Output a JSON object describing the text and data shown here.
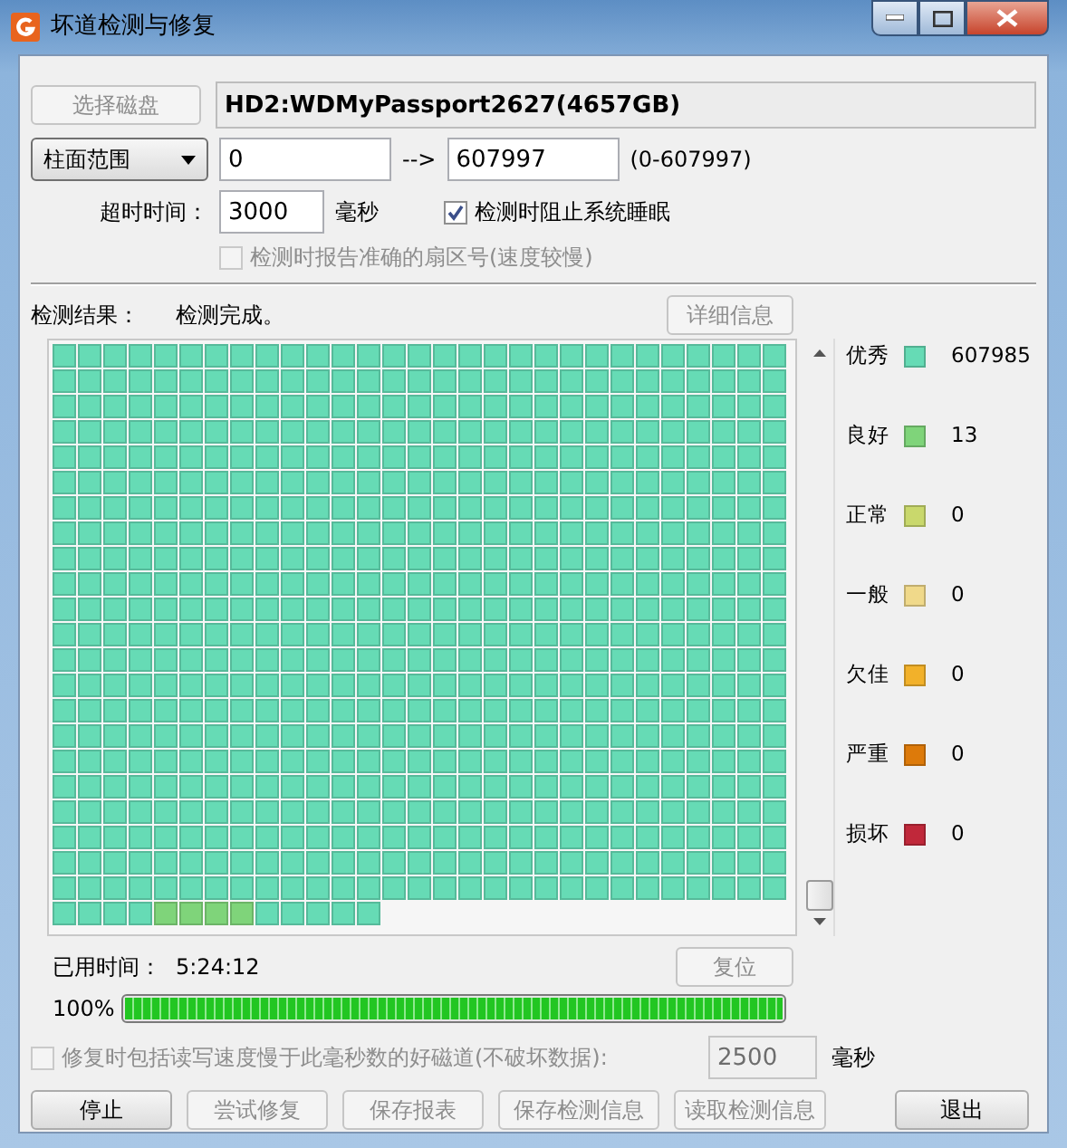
{
  "window": {
    "title": "坏道检测与修复"
  },
  "disk": {
    "select_button": {
      "label": "选择磁盘",
      "disabled": true
    },
    "name": "HD2:WDMyPassport2627(4657GB)"
  },
  "range": {
    "mode": "柱面范围",
    "from": "0",
    "arrow": "-->",
    "to": "607997",
    "hint": "(0-607997)"
  },
  "timeout": {
    "label": "超时时间：",
    "value": "3000",
    "unit": "毫秒"
  },
  "options": [
    {
      "label": "检测时阻止系统睡眠",
      "checked": true,
      "disabled": false
    },
    {
      "label": "检测时报告准确的扇区号(速度较慢)",
      "checked": false,
      "disabled": true
    }
  ],
  "result": {
    "label": "检测结果：",
    "status": "检测完成。",
    "details_button": {
      "label": "详细信息",
      "disabled": true
    }
  },
  "block_map": {
    "rows": [
      [
        {
          "kind": "excellent"
        },
        {
          "kind": "excellent"
        },
        {
          "kind": "excellent"
        },
        {
          "kind": "excellent"
        },
        {
          "kind": "excellent"
        },
        {
          "kind": "excellent"
        },
        {
          "kind": "excellent"
        },
        {
          "kind": "excellent"
        },
        {
          "kind": "excellent"
        },
        {
          "kind": "excellent"
        },
        {
          "kind": "excellent"
        },
        {
          "kind": "excellent"
        },
        {
          "kind": "excellent"
        },
        {
          "kind": "excellent"
        },
        {
          "kind": "excellent"
        },
        {
          "kind": "excellent"
        },
        {
          "kind": "excellent"
        },
        {
          "kind": "excellent"
        },
        {
          "kind": "excellent"
        },
        {
          "kind": "excellent"
        },
        {
          "kind": "excellent"
        },
        {
          "kind": "excellent"
        },
        {
          "kind": "excellent"
        },
        {
          "kind": "excellent"
        },
        {
          "kind": "excellent"
        },
        {
          "kind": "excellent"
        },
        {
          "kind": "excellent"
        },
        {
          "kind": "excellent"
        },
        {
          "kind": "excellent"
        }
      ],
      [
        {
          "kind": "excellent"
        },
        {
          "kind": "excellent"
        },
        {
          "kind": "excellent"
        },
        {
          "kind": "excellent"
        },
        {
          "kind": "excellent"
        },
        {
          "kind": "excellent"
        },
        {
          "kind": "excellent"
        },
        {
          "kind": "excellent"
        },
        {
          "kind": "excellent"
        },
        {
          "kind": "excellent"
        },
        {
          "kind": "excellent"
        },
        {
          "kind": "excellent"
        },
        {
          "kind": "excellent"
        },
        {
          "kind": "excellent"
        },
        {
          "kind": "excellent"
        },
        {
          "kind": "excellent"
        },
        {
          "kind": "excellent"
        },
        {
          "kind": "excellent"
        },
        {
          "kind": "excellent"
        },
        {
          "kind": "excellent"
        },
        {
          "kind": "excellent"
        },
        {
          "kind": "excellent"
        },
        {
          "kind": "excellent"
        },
        {
          "kind": "excellent"
        },
        {
          "kind": "excellent"
        },
        {
          "kind": "excellent"
        },
        {
          "kind": "excellent"
        },
        {
          "kind": "excellent"
        },
        {
          "kind": "excellent"
        }
      ],
      [
        {
          "kind": "excellent"
        },
        {
          "kind": "excellent"
        },
        {
          "kind": "excellent"
        },
        {
          "kind": "excellent"
        },
        {
          "kind": "excellent"
        },
        {
          "kind": "excellent"
        },
        {
          "kind": "excellent"
        },
        {
          "kind": "excellent"
        },
        {
          "kind": "excellent"
        },
        {
          "kind": "excellent"
        },
        {
          "kind": "excellent"
        },
        {
          "kind": "excellent"
        },
        {
          "kind": "excellent"
        },
        {
          "kind": "excellent"
        },
        {
          "kind": "excellent"
        },
        {
          "kind": "excellent"
        },
        {
          "kind": "excellent"
        },
        {
          "kind": "excellent"
        },
        {
          "kind": "excellent"
        },
        {
          "kind": "excellent"
        },
        {
          "kind": "excellent"
        },
        {
          "kind": "excellent"
        },
        {
          "kind": "excellent"
        },
        {
          "kind": "excellent"
        },
        {
          "kind": "excellent"
        },
        {
          "kind": "excellent"
        },
        {
          "kind": "excellent"
        },
        {
          "kind": "excellent"
        },
        {
          "kind": "excellent"
        }
      ],
      [
        {
          "kind": "excellent"
        },
        {
          "kind": "excellent"
        },
        {
          "kind": "excellent"
        },
        {
          "kind": "excellent"
        },
        {
          "kind": "excellent"
        },
        {
          "kind": "excellent"
        },
        {
          "kind": "excellent"
        },
        {
          "kind": "excellent"
        },
        {
          "kind": "excellent"
        },
        {
          "kind": "excellent"
        },
        {
          "kind": "excellent"
        },
        {
          "kind": "excellent"
        },
        {
          "kind": "excellent"
        },
        {
          "kind": "excellent"
        },
        {
          "kind": "excellent"
        },
        {
          "kind": "excellent"
        },
        {
          "kind": "excellent"
        },
        {
          "kind": "excellent"
        },
        {
          "kind": "excellent"
        },
        {
          "kind": "excellent"
        },
        {
          "kind": "excellent"
        },
        {
          "kind": "excellent"
        },
        {
          "kind": "excellent"
        },
        {
          "kind": "excellent"
        },
        {
          "kind": "excellent"
        },
        {
          "kind": "excellent"
        },
        {
          "kind": "excellent"
        },
        {
          "kind": "excellent"
        },
        {
          "kind": "excellent"
        }
      ],
      [
        {
          "kind": "excellent"
        },
        {
          "kind": "excellent"
        },
        {
          "kind": "excellent"
        },
        {
          "kind": "excellent"
        },
        {
          "kind": "excellent"
        },
        {
          "kind": "excellent"
        },
        {
          "kind": "excellent"
        },
        {
          "kind": "excellent"
        },
        {
          "kind": "excellent"
        },
        {
          "kind": "excellent"
        },
        {
          "kind": "excellent"
        },
        {
          "kind": "excellent"
        },
        {
          "kind": "excellent"
        },
        {
          "kind": "excellent"
        },
        {
          "kind": "excellent"
        },
        {
          "kind": "excellent"
        },
        {
          "kind": "excellent"
        },
        {
          "kind": "excellent"
        },
        {
          "kind": "excellent"
        },
        {
          "kind": "excellent"
        },
        {
          "kind": "excellent"
        },
        {
          "kind": "excellent"
        },
        {
          "kind": "excellent"
        },
        {
          "kind": "excellent"
        },
        {
          "kind": "excellent"
        },
        {
          "kind": "excellent"
        },
        {
          "kind": "excellent"
        },
        {
          "kind": "excellent"
        },
        {
          "kind": "excellent"
        }
      ],
      [
        {
          "kind": "excellent"
        },
        {
          "kind": "excellent"
        },
        {
          "kind": "excellent"
        },
        {
          "kind": "excellent"
        },
        {
          "kind": "excellent"
        },
        {
          "kind": "excellent"
        },
        {
          "kind": "excellent"
        },
        {
          "kind": "excellent"
        },
        {
          "kind": "excellent"
        },
        {
          "kind": "excellent"
        },
        {
          "kind": "excellent"
        },
        {
          "kind": "excellent"
        },
        {
          "kind": "excellent"
        },
        {
          "kind": "excellent"
        },
        {
          "kind": "excellent"
        },
        {
          "kind": "excellent"
        },
        {
          "kind": "excellent"
        },
        {
          "kind": "excellent"
        },
        {
          "kind": "excellent"
        },
        {
          "kind": "excellent"
        },
        {
          "kind": "excellent"
        },
        {
          "kind": "excellent"
        },
        {
          "kind": "excellent"
        },
        {
          "kind": "excellent"
        },
        {
          "kind": "excellent"
        },
        {
          "kind": "excellent"
        },
        {
          "kind": "excellent"
        },
        {
          "kind": "excellent"
        },
        {
          "kind": "excellent"
        }
      ],
      [
        {
          "kind": "excellent"
        },
        {
          "kind": "excellent"
        },
        {
          "kind": "excellent"
        },
        {
          "kind": "excellent"
        },
        {
          "kind": "excellent"
        },
        {
          "kind": "excellent"
        },
        {
          "kind": "excellent"
        },
        {
          "kind": "excellent"
        },
        {
          "kind": "excellent"
        },
        {
          "kind": "excellent"
        },
        {
          "kind": "excellent"
        },
        {
          "kind": "excellent"
        },
        {
          "kind": "excellent"
        },
        {
          "kind": "excellent"
        },
        {
          "kind": "excellent"
        },
        {
          "kind": "excellent"
        },
        {
          "kind": "excellent"
        },
        {
          "kind": "excellent"
        },
        {
          "kind": "excellent"
        },
        {
          "kind": "excellent"
        },
        {
          "kind": "excellent"
        },
        {
          "kind": "excellent"
        },
        {
          "kind": "excellent"
        },
        {
          "kind": "excellent"
        },
        {
          "kind": "excellent"
        },
        {
          "kind": "excellent"
        },
        {
          "kind": "excellent"
        },
        {
          "kind": "excellent"
        },
        {
          "kind": "excellent"
        }
      ],
      [
        {
          "kind": "excellent"
        },
        {
          "kind": "excellent"
        },
        {
          "kind": "excellent"
        },
        {
          "kind": "excellent"
        },
        {
          "kind": "excellent"
        },
        {
          "kind": "excellent"
        },
        {
          "kind": "excellent"
        },
        {
          "kind": "excellent"
        },
        {
          "kind": "excellent"
        },
        {
          "kind": "excellent"
        },
        {
          "kind": "excellent"
        },
        {
          "kind": "excellent"
        },
        {
          "kind": "excellent"
        },
        {
          "kind": "excellent"
        },
        {
          "kind": "excellent"
        },
        {
          "kind": "excellent"
        },
        {
          "kind": "excellent"
        },
        {
          "kind": "excellent"
        },
        {
          "kind": "excellent"
        },
        {
          "kind": "excellent"
        },
        {
          "kind": "excellent"
        },
        {
          "kind": "excellent"
        },
        {
          "kind": "excellent"
        },
        {
          "kind": "excellent"
        },
        {
          "kind": "excellent"
        },
        {
          "kind": "excellent"
        },
        {
          "kind": "excellent"
        },
        {
          "kind": "excellent"
        },
        {
          "kind": "excellent"
        }
      ],
      [
        {
          "kind": "excellent"
        },
        {
          "kind": "excellent"
        },
        {
          "kind": "excellent"
        },
        {
          "kind": "excellent"
        },
        {
          "kind": "excellent"
        },
        {
          "kind": "excellent"
        },
        {
          "kind": "excellent"
        },
        {
          "kind": "excellent"
        },
        {
          "kind": "excellent"
        },
        {
          "kind": "excellent"
        },
        {
          "kind": "excellent"
        },
        {
          "kind": "excellent"
        },
        {
          "kind": "excellent"
        },
        {
          "kind": "excellent"
        },
        {
          "kind": "excellent"
        },
        {
          "kind": "excellent"
        },
        {
          "kind": "excellent"
        },
        {
          "kind": "excellent"
        },
        {
          "kind": "excellent"
        },
        {
          "kind": "excellent"
        },
        {
          "kind": "excellent"
        },
        {
          "kind": "excellent"
        },
        {
          "kind": "excellent"
        },
        {
          "kind": "excellent"
        },
        {
          "kind": "excellent"
        },
        {
          "kind": "excellent"
        },
        {
          "kind": "excellent"
        },
        {
          "kind": "excellent"
        },
        {
          "kind": "excellent"
        }
      ],
      [
        {
          "kind": "excellent"
        },
        {
          "kind": "excellent"
        },
        {
          "kind": "excellent"
        },
        {
          "kind": "excellent"
        },
        {
          "kind": "excellent"
        },
        {
          "kind": "excellent"
        },
        {
          "kind": "excellent"
        },
        {
          "kind": "excellent"
        },
        {
          "kind": "excellent"
        },
        {
          "kind": "excellent"
        },
        {
          "kind": "excellent"
        },
        {
          "kind": "excellent"
        },
        {
          "kind": "excellent"
        },
        {
          "kind": "excellent"
        },
        {
          "kind": "excellent"
        },
        {
          "kind": "excellent"
        },
        {
          "kind": "excellent"
        },
        {
          "kind": "excellent"
        },
        {
          "kind": "excellent"
        },
        {
          "kind": "excellent"
        },
        {
          "kind": "excellent"
        },
        {
          "kind": "excellent"
        },
        {
          "kind": "excellent"
        },
        {
          "kind": "excellent"
        },
        {
          "kind": "excellent"
        },
        {
          "kind": "excellent"
        },
        {
          "kind": "excellent"
        },
        {
          "kind": "excellent"
        },
        {
          "kind": "excellent"
        }
      ],
      [
        {
          "kind": "excellent"
        },
        {
          "kind": "excellent"
        },
        {
          "kind": "excellent"
        },
        {
          "kind": "excellent"
        },
        {
          "kind": "excellent"
        },
        {
          "kind": "excellent"
        },
        {
          "kind": "excellent"
        },
        {
          "kind": "excellent"
        },
        {
          "kind": "excellent"
        },
        {
          "kind": "excellent"
        },
        {
          "kind": "excellent"
        },
        {
          "kind": "excellent"
        },
        {
          "kind": "excellent"
        },
        {
          "kind": "excellent"
        },
        {
          "kind": "excellent"
        },
        {
          "kind": "excellent"
        },
        {
          "kind": "excellent"
        },
        {
          "kind": "excellent"
        },
        {
          "kind": "excellent"
        },
        {
          "kind": "excellent"
        },
        {
          "kind": "excellent"
        },
        {
          "kind": "excellent"
        },
        {
          "kind": "excellent"
        },
        {
          "kind": "excellent"
        },
        {
          "kind": "excellent"
        },
        {
          "kind": "excellent"
        },
        {
          "kind": "excellent"
        },
        {
          "kind": "excellent"
        },
        {
          "kind": "excellent"
        }
      ],
      [
        {
          "kind": "excellent"
        },
        {
          "kind": "excellent"
        },
        {
          "kind": "excellent"
        },
        {
          "kind": "excellent"
        },
        {
          "kind": "excellent"
        },
        {
          "kind": "excellent"
        },
        {
          "kind": "excellent"
        },
        {
          "kind": "excellent"
        },
        {
          "kind": "excellent"
        },
        {
          "kind": "excellent"
        },
        {
          "kind": "excellent"
        },
        {
          "kind": "excellent"
        },
        {
          "kind": "excellent"
        },
        {
          "kind": "excellent"
        },
        {
          "kind": "excellent"
        },
        {
          "kind": "excellent"
        },
        {
          "kind": "excellent"
        },
        {
          "kind": "excellent"
        },
        {
          "kind": "excellent"
        },
        {
          "kind": "excellent"
        },
        {
          "kind": "excellent"
        },
        {
          "kind": "excellent"
        },
        {
          "kind": "excellent"
        },
        {
          "kind": "excellent"
        },
        {
          "kind": "excellent"
        },
        {
          "kind": "excellent"
        },
        {
          "kind": "excellent"
        },
        {
          "kind": "excellent"
        },
        {
          "kind": "excellent"
        }
      ],
      [
        {
          "kind": "excellent"
        },
        {
          "kind": "excellent"
        },
        {
          "kind": "excellent"
        },
        {
          "kind": "excellent"
        },
        {
          "kind": "excellent"
        },
        {
          "kind": "excellent"
        },
        {
          "kind": "excellent"
        },
        {
          "kind": "excellent"
        },
        {
          "kind": "excellent"
        },
        {
          "kind": "excellent"
        },
        {
          "kind": "excellent"
        },
        {
          "kind": "excellent"
        },
        {
          "kind": "excellent"
        },
        {
          "kind": "excellent"
        },
        {
          "kind": "excellent"
        },
        {
          "kind": "excellent"
        },
        {
          "kind": "excellent"
        },
        {
          "kind": "excellent"
        },
        {
          "kind": "excellent"
        },
        {
          "kind": "excellent"
        },
        {
          "kind": "excellent"
        },
        {
          "kind": "excellent"
        },
        {
          "kind": "excellent"
        },
        {
          "kind": "excellent"
        },
        {
          "kind": "excellent"
        },
        {
          "kind": "excellent"
        },
        {
          "kind": "excellent"
        },
        {
          "kind": "excellent"
        },
        {
          "kind": "excellent"
        }
      ],
      [
        {
          "kind": "excellent"
        },
        {
          "kind": "excellent"
        },
        {
          "kind": "excellent"
        },
        {
          "kind": "excellent"
        },
        {
          "kind": "excellent"
        },
        {
          "kind": "excellent"
        },
        {
          "kind": "excellent"
        },
        {
          "kind": "excellent"
        },
        {
          "kind": "excellent"
        },
        {
          "kind": "excellent"
        },
        {
          "kind": "excellent"
        },
        {
          "kind": "excellent"
        },
        {
          "kind": "excellent"
        },
        {
          "kind": "excellent"
        },
        {
          "kind": "excellent"
        },
        {
          "kind": "excellent"
        },
        {
          "kind": "excellent"
        },
        {
          "kind": "excellent"
        },
        {
          "kind": "excellent"
        },
        {
          "kind": "excellent"
        },
        {
          "kind": "excellent"
        },
        {
          "kind": "excellent"
        },
        {
          "kind": "excellent"
        },
        {
          "kind": "excellent"
        },
        {
          "kind": "excellent"
        },
        {
          "kind": "excellent"
        },
        {
          "kind": "excellent"
        },
        {
          "kind": "excellent"
        },
        {
          "kind": "excellent"
        }
      ],
      [
        {
          "kind": "excellent"
        },
        {
          "kind": "excellent"
        },
        {
          "kind": "excellent"
        },
        {
          "kind": "excellent"
        },
        {
          "kind": "excellent"
        },
        {
          "kind": "excellent"
        },
        {
          "kind": "excellent"
        },
        {
          "kind": "excellent"
        },
        {
          "kind": "excellent"
        },
        {
          "kind": "excellent"
        },
        {
          "kind": "excellent"
        },
        {
          "kind": "excellent"
        },
        {
          "kind": "excellent"
        },
        {
          "kind": "excellent"
        },
        {
          "kind": "excellent"
        },
        {
          "kind": "excellent"
        },
        {
          "kind": "excellent"
        },
        {
          "kind": "excellent"
        },
        {
          "kind": "excellent"
        },
        {
          "kind": "excellent"
        },
        {
          "kind": "excellent"
        },
        {
          "kind": "excellent"
        },
        {
          "kind": "excellent"
        },
        {
          "kind": "excellent"
        },
        {
          "kind": "excellent"
        },
        {
          "kind": "excellent"
        },
        {
          "kind": "excellent"
        },
        {
          "kind": "excellent"
        },
        {
          "kind": "excellent"
        }
      ],
      [
        {
          "kind": "excellent"
        },
        {
          "kind": "excellent"
        },
        {
          "kind": "excellent"
        },
        {
          "kind": "excellent"
        },
        {
          "kind": "excellent"
        },
        {
          "kind": "excellent"
        },
        {
          "kind": "excellent"
        },
        {
          "kind": "excellent"
        },
        {
          "kind": "excellent"
        },
        {
          "kind": "excellent"
        },
        {
          "kind": "excellent"
        },
        {
          "kind": "excellent"
        },
        {
          "kind": "excellent"
        },
        {
          "kind": "excellent"
        },
        {
          "kind": "excellent"
        },
        {
          "kind": "excellent"
        },
        {
          "kind": "excellent"
        },
        {
          "kind": "excellent"
        },
        {
          "kind": "excellent"
        },
        {
          "kind": "excellent"
        },
        {
          "kind": "excellent"
        },
        {
          "kind": "excellent"
        },
        {
          "kind": "excellent"
        },
        {
          "kind": "excellent"
        },
        {
          "kind": "excellent"
        },
        {
          "kind": "excellent"
        },
        {
          "kind": "excellent"
        },
        {
          "kind": "excellent"
        },
        {
          "kind": "excellent"
        }
      ],
      [
        {
          "kind": "excellent"
        },
        {
          "kind": "excellent"
        },
        {
          "kind": "excellent"
        },
        {
          "kind": "excellent"
        },
        {
          "kind": "excellent"
        },
        {
          "kind": "excellent"
        },
        {
          "kind": "excellent"
        },
        {
          "kind": "excellent"
        },
        {
          "kind": "excellent"
        },
        {
          "kind": "excellent"
        },
        {
          "kind": "excellent"
        },
        {
          "kind": "excellent"
        },
        {
          "kind": "excellent"
        },
        {
          "kind": "excellent"
        },
        {
          "kind": "excellent"
        },
        {
          "kind": "excellent"
        },
        {
          "kind": "excellent"
        },
        {
          "kind": "excellent"
        },
        {
          "kind": "excellent"
        },
        {
          "kind": "excellent"
        },
        {
          "kind": "excellent"
        },
        {
          "kind": "excellent"
        },
        {
          "kind": "excellent"
        },
        {
          "kind": "excellent"
        },
        {
          "kind": "excellent"
        },
        {
          "kind": "excellent"
        },
        {
          "kind": "excellent"
        },
        {
          "kind": "excellent"
        },
        {
          "kind": "excellent"
        }
      ],
      [
        {
          "kind": "excellent"
        },
        {
          "kind": "excellent"
        },
        {
          "kind": "excellent"
        },
        {
          "kind": "excellent"
        },
        {
          "kind": "excellent"
        },
        {
          "kind": "excellent"
        },
        {
          "kind": "excellent"
        },
        {
          "kind": "excellent"
        },
        {
          "kind": "excellent"
        },
        {
          "kind": "excellent"
        },
        {
          "kind": "excellent"
        },
        {
          "kind": "excellent"
        },
        {
          "kind": "excellent"
        },
        {
          "kind": "excellent"
        },
        {
          "kind": "excellent"
        },
        {
          "kind": "excellent"
        },
        {
          "kind": "excellent"
        },
        {
          "kind": "excellent"
        },
        {
          "kind": "excellent"
        },
        {
          "kind": "excellent"
        },
        {
          "kind": "excellent"
        },
        {
          "kind": "excellent"
        },
        {
          "kind": "excellent"
        },
        {
          "kind": "excellent"
        },
        {
          "kind": "excellent"
        },
        {
          "kind": "excellent"
        },
        {
          "kind": "excellent"
        },
        {
          "kind": "excellent"
        },
        {
          "kind": "excellent"
        }
      ],
      [
        {
          "kind": "excellent"
        },
        {
          "kind": "excellent"
        },
        {
          "kind": "excellent"
        },
        {
          "kind": "excellent"
        },
        {
          "kind": "excellent"
        },
        {
          "kind": "excellent"
        },
        {
          "kind": "excellent"
        },
        {
          "kind": "excellent"
        },
        {
          "kind": "excellent"
        },
        {
          "kind": "excellent"
        },
        {
          "kind": "excellent"
        },
        {
          "kind": "excellent"
        },
        {
          "kind": "excellent"
        },
        {
          "kind": "excellent"
        },
        {
          "kind": "excellent"
        },
        {
          "kind": "excellent"
        },
        {
          "kind": "excellent"
        },
        {
          "kind": "excellent"
        },
        {
          "kind": "excellent"
        },
        {
          "kind": "excellent"
        },
        {
          "kind": "excellent"
        },
        {
          "kind": "excellent"
        },
        {
          "kind": "excellent"
        },
        {
          "kind": "excellent"
        },
        {
          "kind": "excellent"
        },
        {
          "kind": "excellent"
        },
        {
          "kind": "excellent"
        },
        {
          "kind": "excellent"
        },
        {
          "kind": "excellent"
        }
      ],
      [
        {
          "kind": "excellent"
        },
        {
          "kind": "excellent"
        },
        {
          "kind": "excellent"
        },
        {
          "kind": "excellent"
        },
        {
          "kind": "excellent"
        },
        {
          "kind": "excellent"
        },
        {
          "kind": "excellent"
        },
        {
          "kind": "excellent"
        },
        {
          "kind": "excellent"
        },
        {
          "kind": "excellent"
        },
        {
          "kind": "excellent"
        },
        {
          "kind": "excellent"
        },
        {
          "kind": "excellent"
        },
        {
          "kind": "excellent"
        },
        {
          "kind": "excellent"
        },
        {
          "kind": "excellent"
        },
        {
          "kind": "excellent"
        },
        {
          "kind": "excellent"
        },
        {
          "kind": "excellent"
        },
        {
          "kind": "excellent"
        },
        {
          "kind": "excellent"
        },
        {
          "kind": "excellent"
        },
        {
          "kind": "excellent"
        },
        {
          "kind": "excellent"
        },
        {
          "kind": "excellent"
        },
        {
          "kind": "excellent"
        },
        {
          "kind": "excellent"
        },
        {
          "kind": "excellent"
        },
        {
          "kind": "excellent"
        }
      ],
      [
        {
          "kind": "excellent"
        },
        {
          "kind": "excellent"
        },
        {
          "kind": "excellent"
        },
        {
          "kind": "excellent"
        },
        {
          "kind": "excellent"
        },
        {
          "kind": "excellent"
        },
        {
          "kind": "excellent"
        },
        {
          "kind": "excellent"
        },
        {
          "kind": "excellent"
        },
        {
          "kind": "excellent"
        },
        {
          "kind": "excellent"
        },
        {
          "kind": "excellent"
        },
        {
          "kind": "excellent"
        },
        {
          "kind": "excellent"
        },
        {
          "kind": "excellent"
        },
        {
          "kind": "excellent"
        },
        {
          "kind": "excellent"
        },
        {
          "kind": "excellent"
        },
        {
          "kind": "excellent"
        },
        {
          "kind": "excellent"
        },
        {
          "kind": "excellent"
        },
        {
          "kind": "excellent"
        },
        {
          "kind": "excellent"
        },
        {
          "kind": "excellent"
        },
        {
          "kind": "excellent"
        },
        {
          "kind": "excellent"
        },
        {
          "kind": "excellent"
        },
        {
          "kind": "excellent"
        },
        {
          "kind": "excellent"
        }
      ],
      [
        {
          "kind": "excellent"
        },
        {
          "kind": "excellent"
        },
        {
          "kind": "excellent"
        },
        {
          "kind": "excellent"
        },
        {
          "kind": "excellent"
        },
        {
          "kind": "excellent"
        },
        {
          "kind": "excellent"
        },
        {
          "kind": "excellent"
        },
        {
          "kind": "excellent"
        },
        {
          "kind": "excellent"
        },
        {
          "kind": "excellent"
        },
        {
          "kind": "excellent"
        },
        {
          "kind": "excellent"
        },
        {
          "kind": "excellent"
        },
        {
          "kind": "excellent"
        },
        {
          "kind": "excellent"
        },
        {
          "kind": "excellent"
        },
        {
          "kind": "excellent"
        },
        {
          "kind": "excellent"
        },
        {
          "kind": "excellent"
        },
        {
          "kind": "excellent"
        },
        {
          "kind": "excellent"
        },
        {
          "kind": "excellent"
        },
        {
          "kind": "excellent"
        },
        {
          "kind": "excellent"
        },
        {
          "kind": "excellent"
        },
        {
          "kind": "excellent"
        },
        {
          "kind": "excellent"
        },
        {
          "kind": "excellent"
        }
      ],
      [
        {
          "kind": "excellent"
        },
        {
          "kind": "excellent"
        },
        {
          "kind": "excellent"
        },
        {
          "kind": "excellent"
        },
        {
          "kind": "good"
        },
        {
          "kind": "good"
        },
        {
          "kind": "good"
        },
        {
          "kind": "good"
        },
        {
          "kind": "excellent"
        },
        {
          "kind": "excellent"
        },
        {
          "kind": "excellent"
        },
        {
          "kind": "excellent"
        },
        {
          "kind": "excellent"
        }
      ]
    ]
  },
  "legend": [
    {
      "label": "优秀",
      "color": "#66dbb5",
      "count": "607985"
    },
    {
      "label": "良好",
      "color": "#7fd47a",
      "count": "13"
    },
    {
      "label": "正常",
      "color": "#c9d86c",
      "count": "0"
    },
    {
      "label": "一般",
      "color": "#f0d98a",
      "count": "0"
    },
    {
      "label": "欠佳",
      "color": "#f2b12a",
      "count": "0"
    },
    {
      "label": "严重",
      "color": "#dd7a0a",
      "count": "0"
    },
    {
      "label": "损坏",
      "color": "#c0283a",
      "count": "0"
    }
  ],
  "elapsed": {
    "label": "已用时间：",
    "value": "5:24:12"
  },
  "reset_button": {
    "label": "复位",
    "disabled": true
  },
  "progress": {
    "reading": "100%",
    "level": 1
  },
  "repair_option": {
    "label": "修复时包括读写速度慢于此毫秒数的好磁道(不破坏数据):",
    "checked": false,
    "disabled": true,
    "value": "2500",
    "unit": "毫秒"
  },
  "buttons": [
    {
      "label": "停止",
      "disabled": false
    },
    {
      "label": "尝试修复",
      "disabled": true
    },
    {
      "label": "保存报表",
      "disabled": true
    },
    {
      "label": "保存检测信息",
      "disabled": true
    },
    {
      "label": "读取检测信息",
      "disabled": true
    },
    {
      "label": "退出",
      "disabled": false
    }
  ]
}
